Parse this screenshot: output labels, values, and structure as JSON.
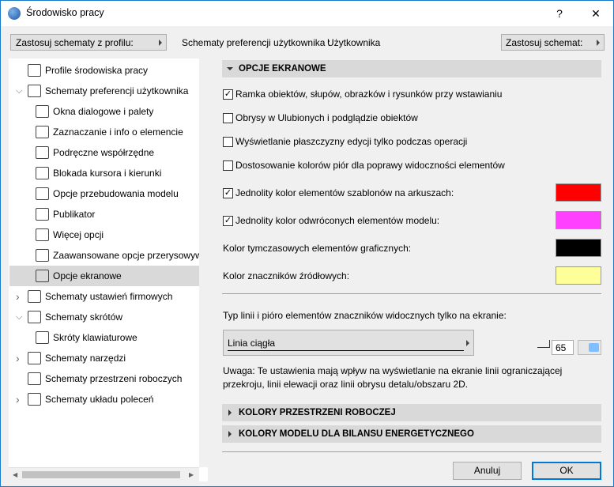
{
  "window": {
    "title": "Środowisko pracy",
    "help": "?",
    "close": "✕"
  },
  "toolbar": {
    "apply_profile": "Zastosuj schematy z profilu:",
    "scheme_label": "Schematy preferencji użytkownika :",
    "scheme_value": "Użytkownika",
    "apply_scheme": "Zastosuj schemat:"
  },
  "tree": [
    {
      "label": "Profile środowiska pracy",
      "icon": "monitor-gear-icon",
      "level": 0
    },
    {
      "label": "Schematy preferencji użytkownika",
      "icon": "user-scheme-icon",
      "level": 0,
      "expanded": true
    },
    {
      "label": "Okna dialogowe i palety",
      "icon": "dialogs-icon",
      "level": 1
    },
    {
      "label": "Zaznaczanie i info o elemencie",
      "icon": "selection-icon",
      "level": 1
    },
    {
      "label": "Podręczne współrzędne",
      "icon": "xyz-icon",
      "level": 1
    },
    {
      "label": "Blokada kursora i kierunki",
      "icon": "cursor-icon",
      "level": 1
    },
    {
      "label": "Opcje przebudowania modelu",
      "icon": "rebuild-icon",
      "level": 1
    },
    {
      "label": "Publikator",
      "icon": "publisher-icon",
      "level": 1
    },
    {
      "label": "Więcej opcji",
      "icon": "sliders-icon",
      "level": 1
    },
    {
      "label": "Zaawansowane opcje przerysowywania",
      "icon": "redraw-icon",
      "level": 1
    },
    {
      "label": "Opcje ekranowe",
      "icon": "screen-icon",
      "level": 1,
      "selected": true
    },
    {
      "label": "Schematy ustawień firmowych",
      "icon": "company-icon",
      "level": 0,
      "expanded": false
    },
    {
      "label": "Schematy skrótów",
      "icon": "shortcut-scheme-icon",
      "level": 0,
      "expanded": true
    },
    {
      "label": "Skróty klawiaturowe",
      "icon": "shortcut-icon",
      "level": 1
    },
    {
      "label": "Schematy narzędzi",
      "icon": "tools-icon",
      "level": 0,
      "expanded": false
    },
    {
      "label": "Schematy przestrzeni roboczych",
      "icon": "workspace-icon",
      "level": 0
    },
    {
      "label": "Schematy układu poleceń",
      "icon": "command-icon",
      "level": 0,
      "expanded": false
    }
  ],
  "main": {
    "section_title": "OPCJE EKRANOWE",
    "options": [
      {
        "label": "Ramka obiektów, słupów, obrazków i rysunków przy wstawianiu",
        "checked": true
      },
      {
        "label": "Obrysy w Ulubionych i podglądzie obiektów",
        "checked": false
      },
      {
        "label": "Wyświetlanie płaszczyzny edycji tylko podczas operacji",
        "checked": false
      },
      {
        "label": "Dostosowanie kolorów piór dla poprawy widoczności elementów",
        "checked": false
      },
      {
        "label": "Jednolity kolor elementów szablonów na arkuszach:",
        "checked": true,
        "color": "#ff0000"
      },
      {
        "label": "Jednolity kolor odwróconych elementów modelu:",
        "checked": true,
        "color": "#ff40ff"
      }
    ],
    "color_rows": [
      {
        "label": "Kolor tymczasowych elementów graficznych:",
        "color": "#000000"
      },
      {
        "label": "Kolor znaczników źródłowych:",
        "color": "#ffff99"
      }
    ],
    "line_label": "Typ linii i pióro elementów znaczników widocznych tylko na ekranie:",
    "line_type": "Linia ciągła",
    "pen_number": "65",
    "pen_color": "#80bfff",
    "note": "Uwaga: Te ustawienia mają wpływ na wyświetlanie na ekranie linii ograniczającej przekroju, linii elewacji oraz linii obrysu detalu/obszaru 2D.",
    "collapsed_sections": [
      "KOLORY PRZESTRZENI ROBOCZEJ",
      "KOLORY MODELU DLA BILANSU ENERGETYCZNEGO"
    ]
  },
  "buttons": {
    "cancel": "Anuluj",
    "ok": "OK"
  }
}
